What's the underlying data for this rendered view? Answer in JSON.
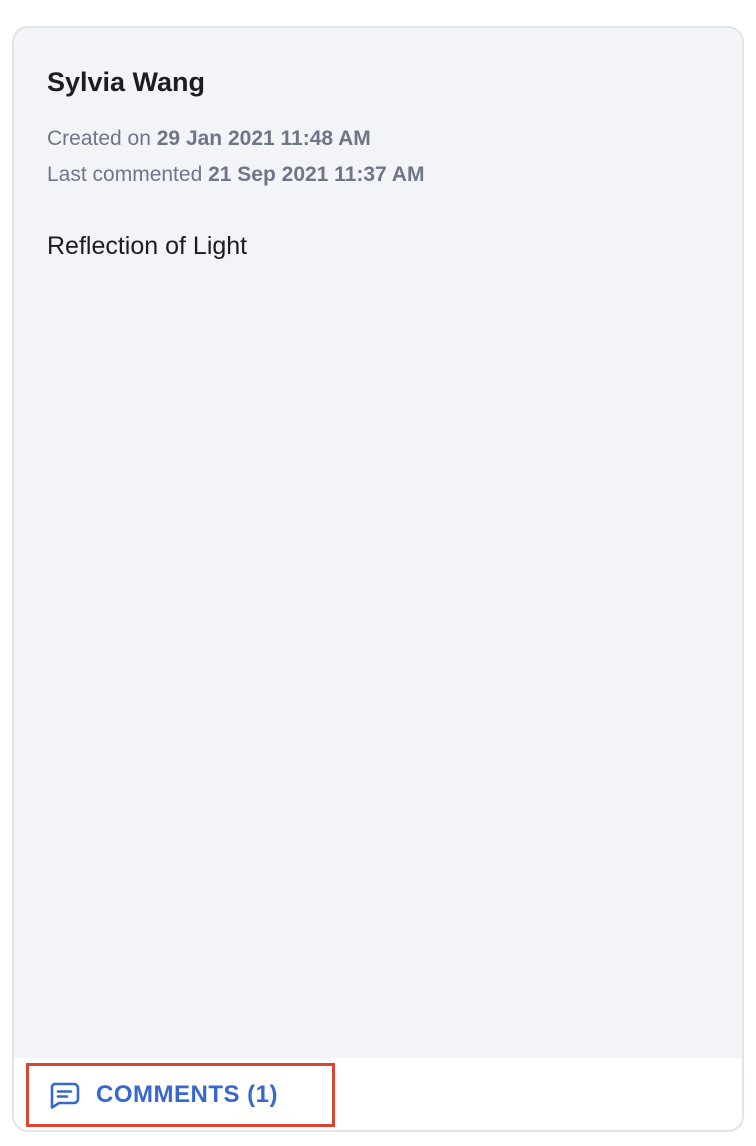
{
  "card": {
    "author": "Sylvia Wang",
    "created_label": "Created on",
    "created_value": "29 Jan 2021 11:48 AM",
    "last_commented_label": "Last commented",
    "last_commented_value": "21 Sep 2021 11:37 AM",
    "topic": "Reflection of Light"
  },
  "footer": {
    "comments_icon": "comment-icon",
    "comments_label": "COMMENTS (1)"
  },
  "colors": {
    "card_background": "#f3f4f8",
    "accent": "#3868cf",
    "highlight_border": "#dd4532",
    "muted_text": "#6e7686"
  }
}
